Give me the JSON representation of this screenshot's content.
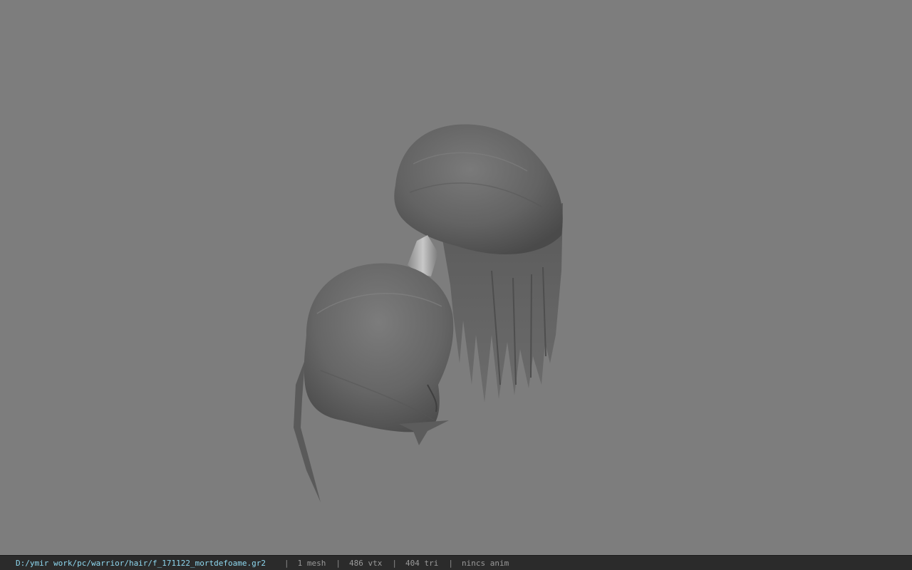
{
  "viewport": {
    "background_color": "#7d7d7d",
    "model": {
      "description_icon": "hair-model",
      "fill_color": "#6a6a6a",
      "shade_color": "#4f4f4f",
      "tie_color": "#a8a8a8"
    }
  },
  "statusbar": {
    "path": "D:/ymir work/pc/warrior/hair/f_171122_mortdefoame.gr2",
    "separator": "|",
    "mesh_count": "1 mesh",
    "vertex_count": "486 vtx",
    "triangle_count": "404 tri",
    "anim_status": "nincs anim",
    "path_color": "#8ed8f0",
    "background_color": "#2b2b2b"
  }
}
